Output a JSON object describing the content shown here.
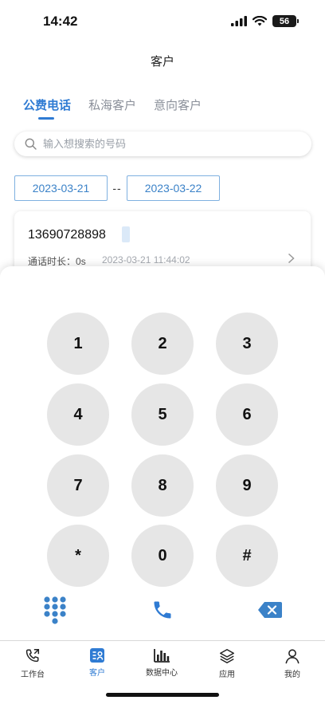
{
  "status_bar": {
    "time": "14:42",
    "battery": "56"
  },
  "header": {
    "title": "客户"
  },
  "tabs": [
    {
      "label": "公费电话",
      "active": true
    },
    {
      "label": "私海客户",
      "active": false
    },
    {
      "label": "意向客户",
      "active": false
    }
  ],
  "search": {
    "placeholder": "输入想搜索的号码",
    "icon": "search-icon"
  },
  "date_range": {
    "start": "2023-03-21",
    "separator": "--",
    "end": "2023-03-22"
  },
  "call_record": {
    "number": "13690728898",
    "duration_label": "通话时长：",
    "duration": "0s",
    "timestamp": "2023-03-21 11:44:02"
  },
  "dialpad": {
    "keys": [
      "1",
      "2",
      "3",
      "4",
      "5",
      "6",
      "7",
      "8",
      "9",
      "*",
      "0",
      "#"
    ],
    "actions": [
      "keypad-icon",
      "phone-icon",
      "backspace-icon"
    ]
  },
  "tabbar": [
    {
      "label": "工作台",
      "icon": "phone-desk-icon",
      "active": false
    },
    {
      "label": "客户",
      "icon": "customer-icon",
      "active": true
    },
    {
      "label": "数据中心",
      "icon": "bar-chart-icon",
      "active": false
    },
    {
      "label": "应用",
      "icon": "layers-icon",
      "active": false
    },
    {
      "label": "我的",
      "icon": "user-icon",
      "active": false
    }
  ],
  "colors": {
    "accent": "#2f7bd3",
    "key_bg": "#e6e6e6",
    "keypad_icon": "#3b82c8"
  }
}
